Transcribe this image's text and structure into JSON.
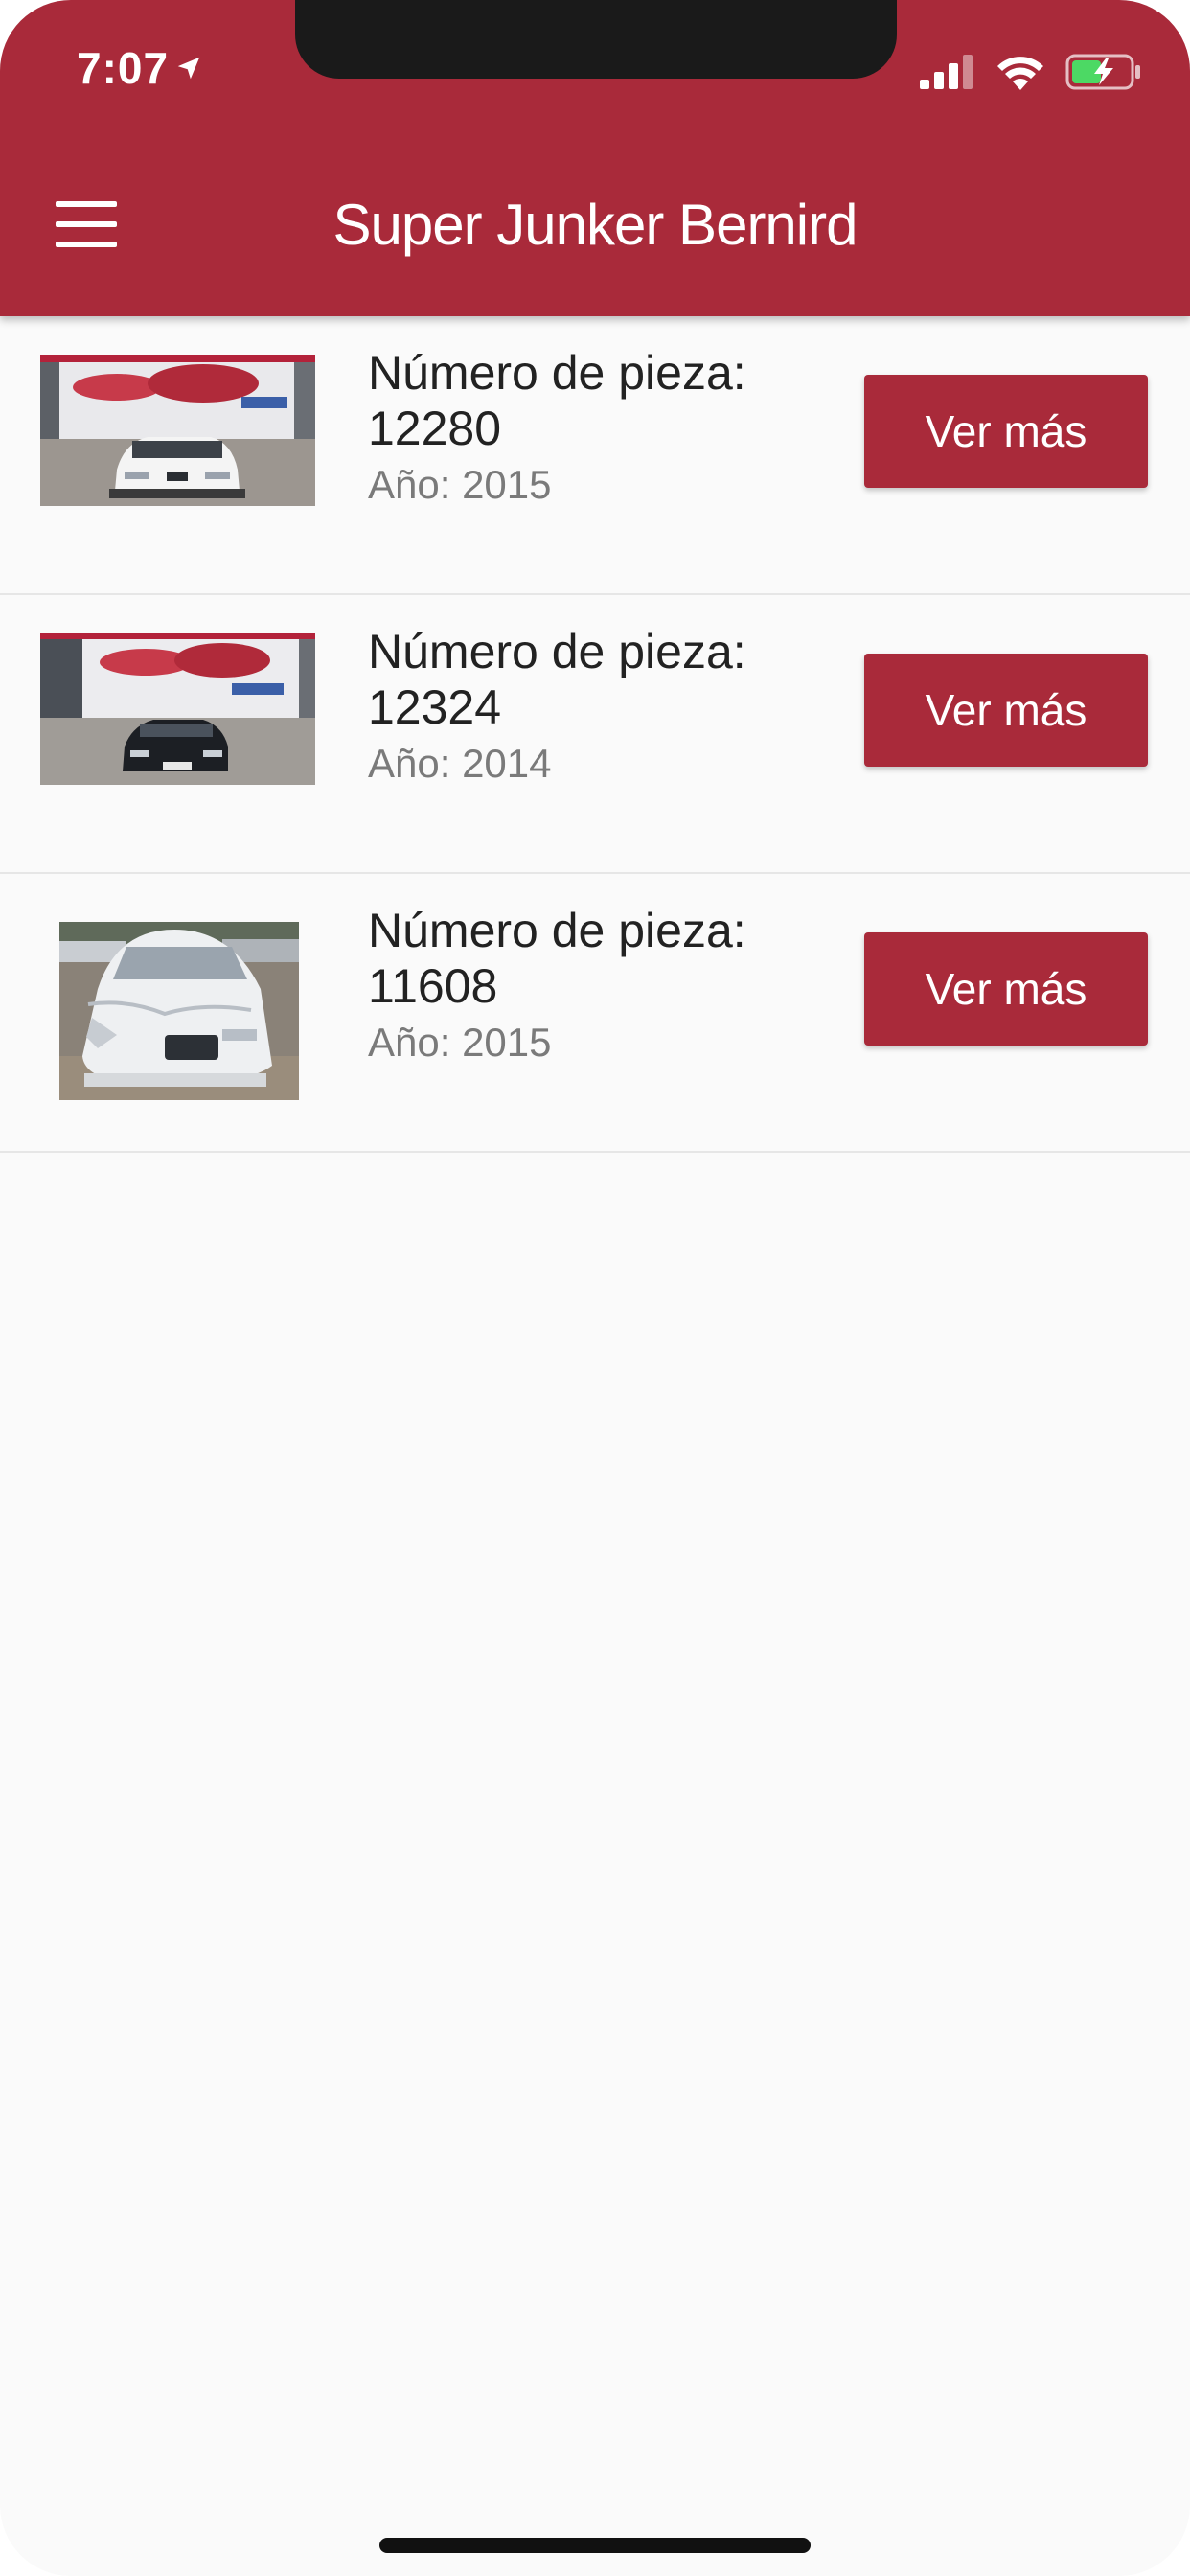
{
  "status_bar": {
    "time": "7:07",
    "icons": [
      "location-arrow-icon",
      "cellular-signal-icon",
      "wifi-icon",
      "battery-charging-icon"
    ]
  },
  "app_bar": {
    "title": "Super Junker Bernird",
    "menu_icon": "hamburger-menu-icon"
  },
  "colors": {
    "primary": "#a92a3a",
    "background": "#fafafa",
    "text_primary": "#222222",
    "text_secondary": "#7a7a7a"
  },
  "items": [
    {
      "part_label": "Número de pieza:",
      "part_number": "12280",
      "year_text": "Año: 2015",
      "button_label": "Ver más",
      "thumbnail": "white-car-photo"
    },
    {
      "part_label": "Número de pieza:",
      "part_number": "12324",
      "year_text": "Año: 2014",
      "button_label": "Ver más",
      "thumbnail": "dark-car-photo"
    },
    {
      "part_label": "Número de pieza:",
      "part_number": "11608",
      "year_text": "Año: 2015",
      "button_label": "Ver más",
      "thumbnail": "damaged-white-car-photo"
    }
  ]
}
